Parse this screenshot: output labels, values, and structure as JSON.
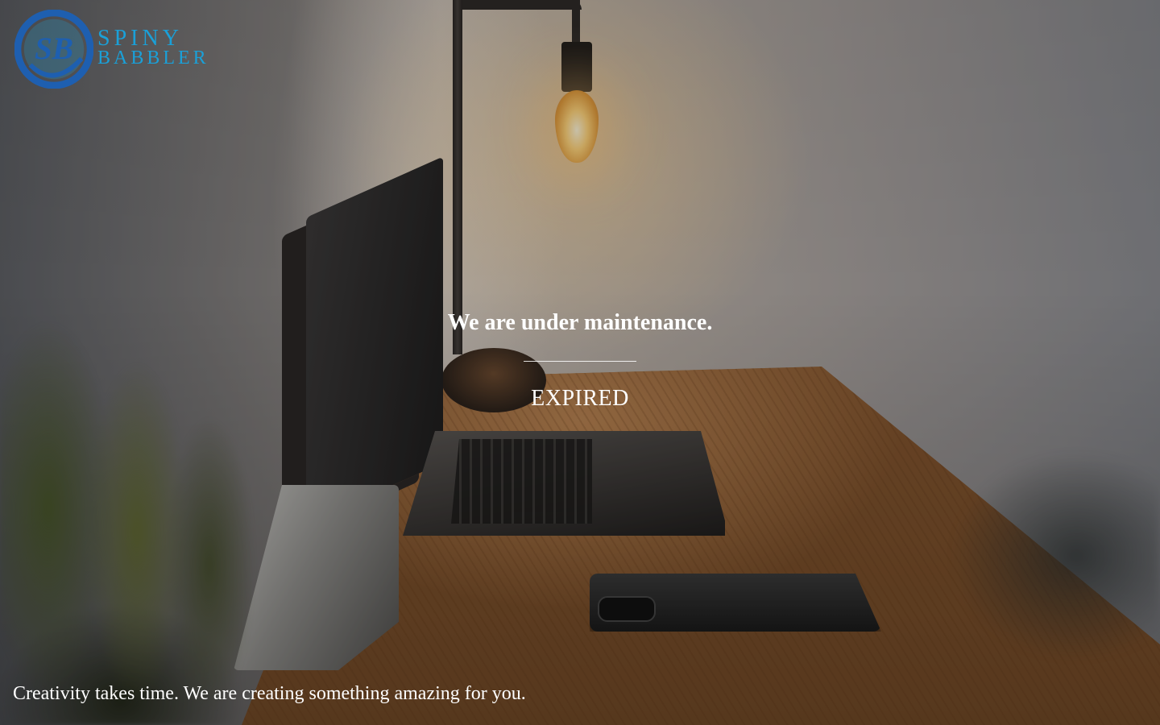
{
  "logo": {
    "mark_text": "SB",
    "word_line_1": "SPINY",
    "word_line_2": "BABBLER",
    "brand_color": "#1aa0d8",
    "mark_color": "#1e5fb0"
  },
  "main": {
    "headline": "We are under maintenance.",
    "status": "EXPIRED"
  },
  "footer": {
    "tagline": "Creativity takes time. We are creating something amazing for you."
  }
}
